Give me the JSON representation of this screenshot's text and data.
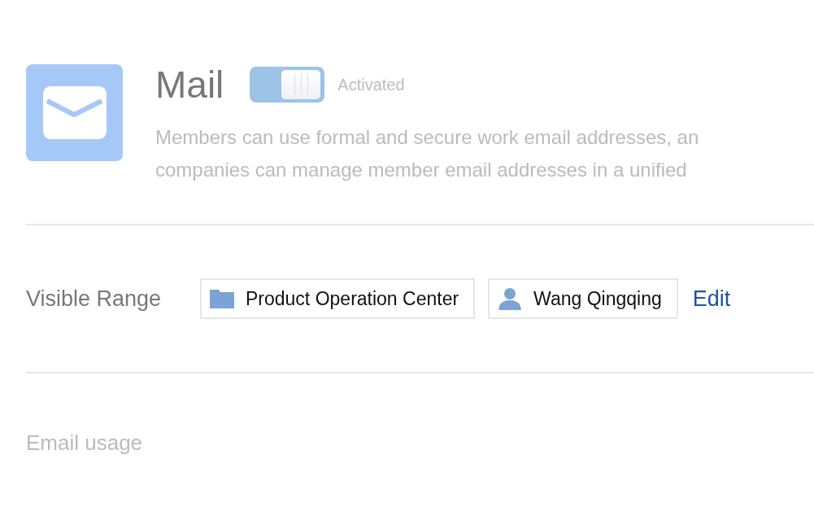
{
  "app": {
    "title": "Mail",
    "switch": {
      "on": true,
      "label": "Activated"
    },
    "description": [
      "Members can use formal and secure work email addresses, an",
      "companies can manage member email addresses in a unified"
    ]
  },
  "visible_range": {
    "label": "Visible Range",
    "tags": [
      {
        "kind": "folder",
        "label": "Product Operation Center"
      },
      {
        "kind": "person",
        "label": "Wang Qingqing"
      }
    ],
    "edit": "Edit"
  },
  "email_usage": {
    "label": "Email usage"
  }
}
